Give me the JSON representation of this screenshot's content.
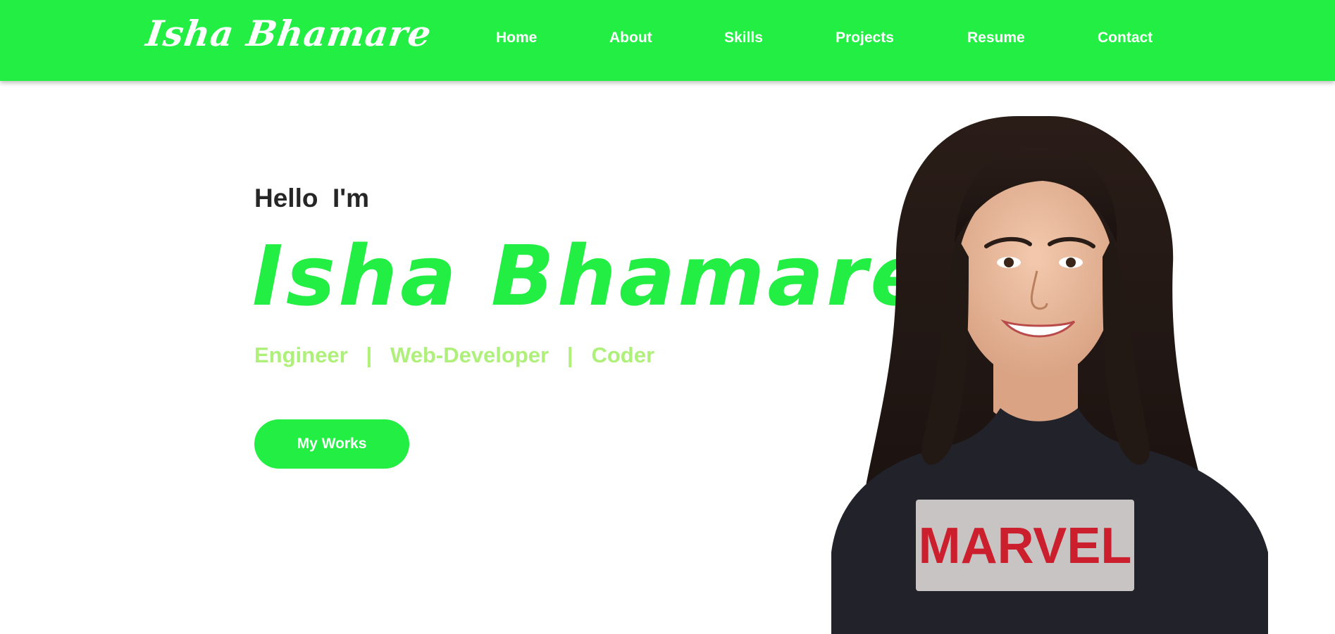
{
  "navbar": {
    "brand": "Isha Bhamare",
    "links": [
      {
        "label": "Home"
      },
      {
        "label": "About"
      },
      {
        "label": "Skills"
      },
      {
        "label": "Projects"
      },
      {
        "label": "Resume"
      },
      {
        "label": "Contact"
      }
    ]
  },
  "hero": {
    "greeting": "Hello  I'm",
    "name": "Isha Bhamare",
    "roles": "Engineer   |   Web-Developer   |   Coder",
    "cta_label": "My Works",
    "shirt_text": "MARVEL"
  },
  "colors": {
    "brand_green": "#22ee44",
    "role_green": "#aef07a",
    "text_dark": "#262626"
  }
}
